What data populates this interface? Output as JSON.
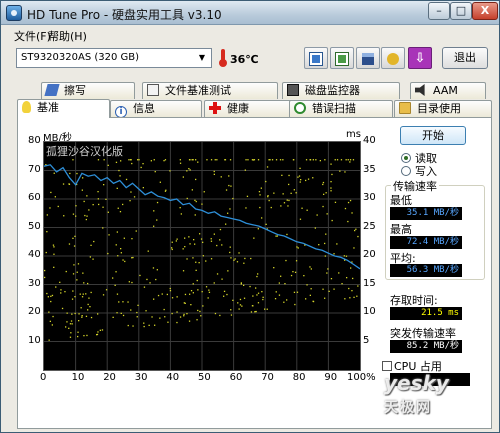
{
  "window": {
    "title": "HD Tune Pro - 硬盘实用工具 v3.10",
    "controls": {
      "minimize": "–",
      "maximize": "□",
      "close": "X"
    }
  },
  "menu": {
    "file": "文件(F)",
    "help": "帮助(H)"
  },
  "toolbar": {
    "drive": "ST9320320AS (320 GB)",
    "temperature": "36℃",
    "icons": [
      "copy-text-icon",
      "copy-screenshot-icon",
      "save-icon",
      "options-icon",
      "download-icon"
    ],
    "exit_label": "退出"
  },
  "tabs": {
    "row1": [
      "擦写",
      "文件基准测试",
      "磁盘监控器",
      "AAM"
    ],
    "row2": [
      "基准",
      "信息",
      "健康",
      "错误扫描",
      "目录使用"
    ],
    "active": "基准"
  },
  "benchmark": {
    "watermark": "孤狸沙谷汉化版",
    "start_label": "开始",
    "read_label": "读取",
    "write_label": "写入",
    "mode": "read",
    "transfer_title": "传输速率",
    "min_label": "最低",
    "min_value": "35.1 MB/秒",
    "max_label": "最高",
    "max_value": "72.4 MB/秒",
    "avg_label": "平均:",
    "avg_value": "56.3 MB/秒",
    "access_label": "存取时间:",
    "access_value": "21.5 ms",
    "burst_label": "突发传输速率",
    "burst_value": "85.2 MB/秒",
    "cpu_label": "CPU 占用"
  },
  "chart_data": {
    "type": "line",
    "ylabel_left": "MB/秒",
    "ylabel_right": "ms",
    "ylim_left": [
      0,
      80
    ],
    "ylim_right": [
      0,
      40
    ],
    "xlim": [
      0,
      100
    ],
    "x_ticks": [
      "0",
      "10",
      "20",
      "30",
      "40",
      "50",
      "60",
      "70",
      "80",
      "90",
      "100%"
    ],
    "y_ticks_left": [
      "10",
      "20",
      "30",
      "40",
      "50",
      "60",
      "70",
      "80"
    ],
    "y_ticks_right": [
      "5",
      "10",
      "15",
      "20",
      "25",
      "30",
      "35",
      "40"
    ],
    "grid": true,
    "series": [
      {
        "name": "transfer",
        "color": "#2e8fd8",
        "x": [
          0,
          2,
          4,
          6,
          8,
          10,
          12,
          14,
          16,
          18,
          20,
          22,
          24,
          26,
          28,
          30,
          32,
          34,
          36,
          38,
          40,
          42,
          44,
          46,
          48,
          50,
          52,
          54,
          56,
          58,
          60,
          62,
          64,
          66,
          68,
          70,
          72,
          74,
          76,
          78,
          80,
          82,
          84,
          86,
          88,
          90,
          92,
          94,
          96,
          98,
          100
        ],
        "y": [
          71.5,
          72.0,
          69.5,
          71.0,
          67.5,
          65.0,
          69.0,
          68.0,
          68.5,
          66.5,
          67.5,
          65.5,
          66.5,
          64.0,
          65.5,
          63.5,
          61.5,
          62.5,
          61.0,
          60.5,
          59.5,
          60.0,
          58.0,
          58.5,
          56.5,
          56.0,
          55.0,
          55.5,
          54.0,
          53.5,
          53.0,
          52.5,
          51.5,
          51.0,
          50.5,
          49.5,
          48.5,
          47.5,
          47.0,
          46.0,
          45.0,
          44.5,
          43.5,
          42.5,
          42.0,
          41.0,
          40.0,
          39.5,
          38.5,
          37.0,
          35.5
        ]
      },
      {
        "name": "access",
        "color": "#d6d62a",
        "style": "scatter",
        "range_ms": [
          5,
          37
        ]
      }
    ]
  }
}
